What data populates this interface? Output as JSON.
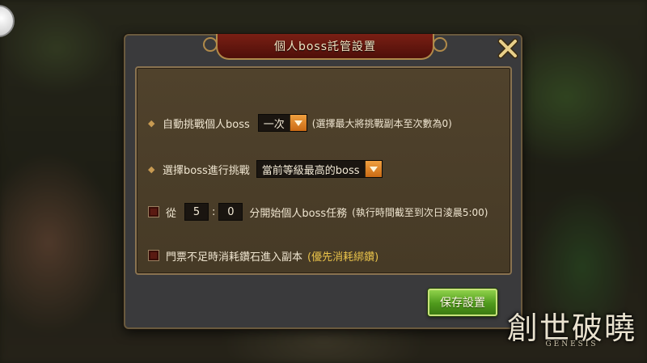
{
  "dialog": {
    "title": "個人boss託管設置",
    "rows": {
      "auto_challenge": {
        "label": "自動挑戰個人boss",
        "select_value": "一次",
        "note": "(選擇最大將挑戰副本至次數為0)"
      },
      "choose_boss": {
        "label": "選擇boss進行挑戰",
        "select_value": "當前等級最高的boss"
      },
      "schedule": {
        "prefix": "從",
        "hour": "5",
        "colon": ":",
        "minute": "0",
        "suffix": "分開始個人boss任務",
        "note": "(執行時間截至到次日淩晨5:00)",
        "checked": false
      },
      "use_diamonds": {
        "label": "門票不足時消耗鑽石進入副本",
        "highlight": "(優先消耗綁鑽)",
        "checked": false
      }
    },
    "save_label": "保存設置"
  },
  "logo": {
    "title": "創世破曉",
    "subtitle": "GENESIS"
  },
  "colors": {
    "accent_gold": "#e8c24a",
    "save_green": "#4f9a1c",
    "title_red": "#7a1f14",
    "dropdown_orange": "#f0a040"
  }
}
